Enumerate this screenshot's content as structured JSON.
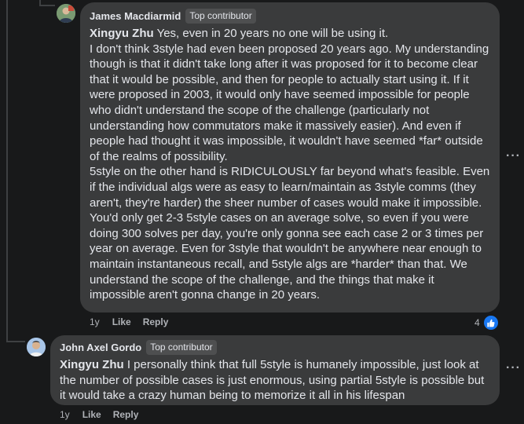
{
  "comments": [
    {
      "author": "James Macdiarmid",
      "badge": "Top contributor",
      "mention": "Xingyu Zhu",
      "first_line": " Yes, even in 20 years no one will be using it.",
      "paragraphs": [
        "I don't think 3style had even been proposed 20 years ago. My understanding though is that it didn't take long after it was proposed for it to become clear that it would be possible, and then for people to actually start using it. If it were proposed in 2003, it would only have seemed impossible for people who didn't understand the scope of the challenge (particularly not understanding how commutators make it massively easier). And even if people had thought it was impossible, it wouldn't have seemed *far* outside of the realms of possibility.",
        "5style on the other hand is RIDICULOUSLY far beyond what's feasible. Even if the individual algs were as easy to learn/maintain as 3style comms (they aren't, they're harder) the sheer number of cases would make it impossible. You'd only get 2-3 5style cases on an average solve, so even if you were doing 300 solves per day, you're only gonna see each case 2 or 3 times per year on average. Even for 3style that wouldn't be anywhere near enough to maintain instantaneous recall, and 5style algs are *harder* than that. We understand the scope of the challenge, and the things that make it impossible aren't gonna change in 20 years."
      ],
      "age": "1y",
      "like_label": "Like",
      "reply_label": "Reply",
      "reaction_count": "4",
      "more_label": "···"
    },
    {
      "author": "John Axel Gordo",
      "badge": "Top contributor",
      "mention": "Xingyu Zhu",
      "first_line": " I personally think that full 5style is humanely impossible, just look at the number of possible cases is just enormous, using partial 5style is possible but it would take a crazy human being to memorize it all in his lifespan",
      "age": "1y",
      "like_label": "Like",
      "reply_label": "Reply",
      "more_label": "···"
    }
  ]
}
